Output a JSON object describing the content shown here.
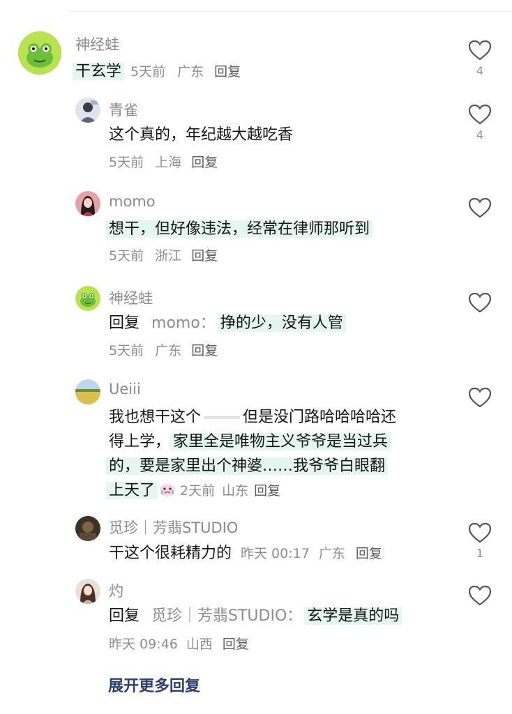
{
  "comments": [
    {
      "user": "神经蛙",
      "content_hl": "干玄学",
      "time": "5天前",
      "location": "广东",
      "reply_label": "回复",
      "likes": "4",
      "avatar_icon": "frog-avatar-icon"
    },
    {
      "user": "青雀",
      "content": "这个真的，年纪越大越吃香",
      "time": "5天前",
      "location": "上海",
      "reply_label": "回复",
      "likes": "4",
      "avatar_icon": "person-avatar-icon"
    },
    {
      "user": "momo",
      "content": "想干，但好像违法，经常在律师那听到",
      "time": "5天前",
      "location": "浙江",
      "reply_label": "回复",
      "likes": "",
      "avatar_icon": "woman-avatar-icon"
    },
    {
      "user": "神经蛙",
      "reply_prefix": "回复",
      "reply_to": "momo：",
      "content": "挣的少，没有人管",
      "time": "5天前",
      "location": "广东",
      "reply_label": "回复",
      "likes": "",
      "avatar_icon": "frog-avatar-icon"
    },
    {
      "user": "Ueiii",
      "lines": [
        "我也想干这个",
        "但是没门路哈哈哈哈还",
        "得上学，",
        "家里全是唯物主义爷爷是当过兵",
        "的，要是家里出个神婆……我爷爷白眼翻",
        "上天了"
      ],
      "time": "2天前",
      "location": "山东",
      "reply_label": "回复",
      "likes": "",
      "avatar_icon": "field-avatar-icon",
      "emoji_icon": "crying-face-emoji-icon"
    },
    {
      "user": "觅珍｜芳翡STUDIO",
      "content": "干这个很耗精力的",
      "time": "昨天 00:17",
      "location": "广东",
      "reply_label": "回复",
      "likes": "1",
      "avatar_icon": "dark-photo-avatar-icon"
    },
    {
      "user": "灼",
      "reply_prefix": "回复",
      "reply_to": "觅珍｜芳翡STUDIO：",
      "content": "玄学是真的吗",
      "time": "昨天 09:46",
      "location": "山西",
      "reply_label": "回复",
      "likes": "",
      "avatar_icon": "girl-avatar-icon"
    }
  ],
  "expand_label": "展开更多回复",
  "colors": {
    "highlight": "#e5f5f0",
    "username": "#8a8a8a",
    "meta": "#8d8d8d",
    "expand_link": "#2b3f72"
  }
}
